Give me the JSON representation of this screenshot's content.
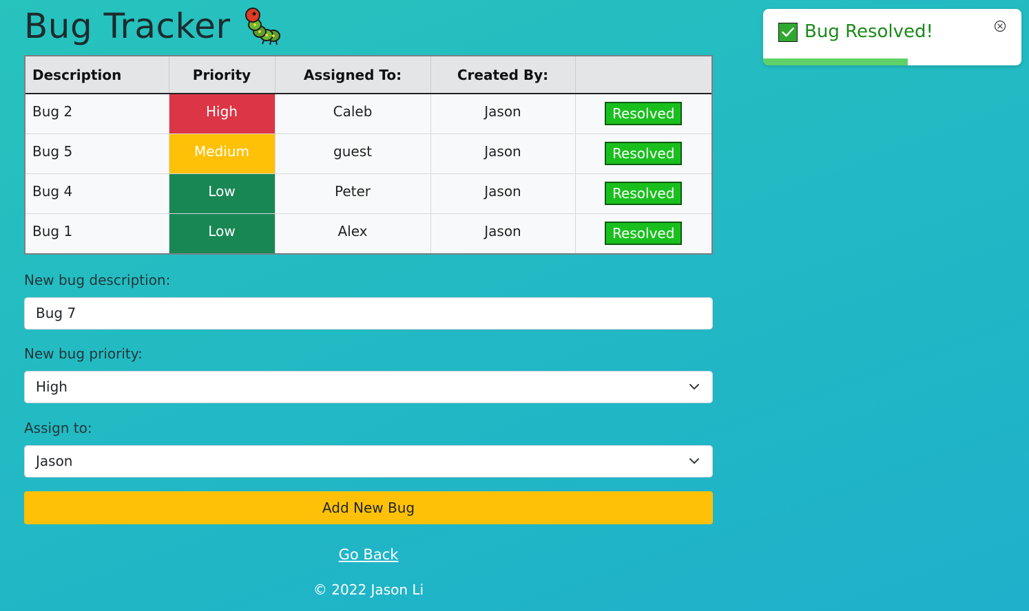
{
  "header": {
    "title": "Bug Tracker",
    "icon": "caterpillar-icon"
  },
  "table": {
    "columns": [
      "Description",
      "Priority",
      "Assigned To:",
      "Created By:",
      ""
    ],
    "rows": [
      {
        "description": "Bug 2",
        "priority": "High",
        "assigned_to": "Caleb",
        "created_by": "Jason",
        "action": "Resolved"
      },
      {
        "description": "Bug 5",
        "priority": "Medium",
        "assigned_to": "guest",
        "created_by": "Jason",
        "action": "Resolved"
      },
      {
        "description": "Bug 4",
        "priority": "Low",
        "assigned_to": "Peter",
        "created_by": "Jason",
        "action": "Resolved"
      },
      {
        "description": "Bug 1",
        "priority": "Low",
        "assigned_to": "Alex",
        "created_by": "Jason",
        "action": "Resolved"
      }
    ]
  },
  "form": {
    "description_label": "New bug description:",
    "description_value": "Bug 7",
    "priority_label": "New bug priority:",
    "priority_value": "High",
    "assign_label": "Assign to:",
    "assign_value": "Jason",
    "submit_label": "Add New Bug"
  },
  "links": {
    "go_back": "Go Back"
  },
  "footer": {
    "text": "© 2022 Jason Li"
  },
  "toast": {
    "message": "Bug Resolved!",
    "progress_fraction": 0.56
  },
  "colors": {
    "high": "#dc3545",
    "medium": "#ffc107",
    "low": "#198754",
    "resolve_button": "#19c01d",
    "add_button": "#ffc107",
    "toast_text": "#1a8a1a"
  }
}
